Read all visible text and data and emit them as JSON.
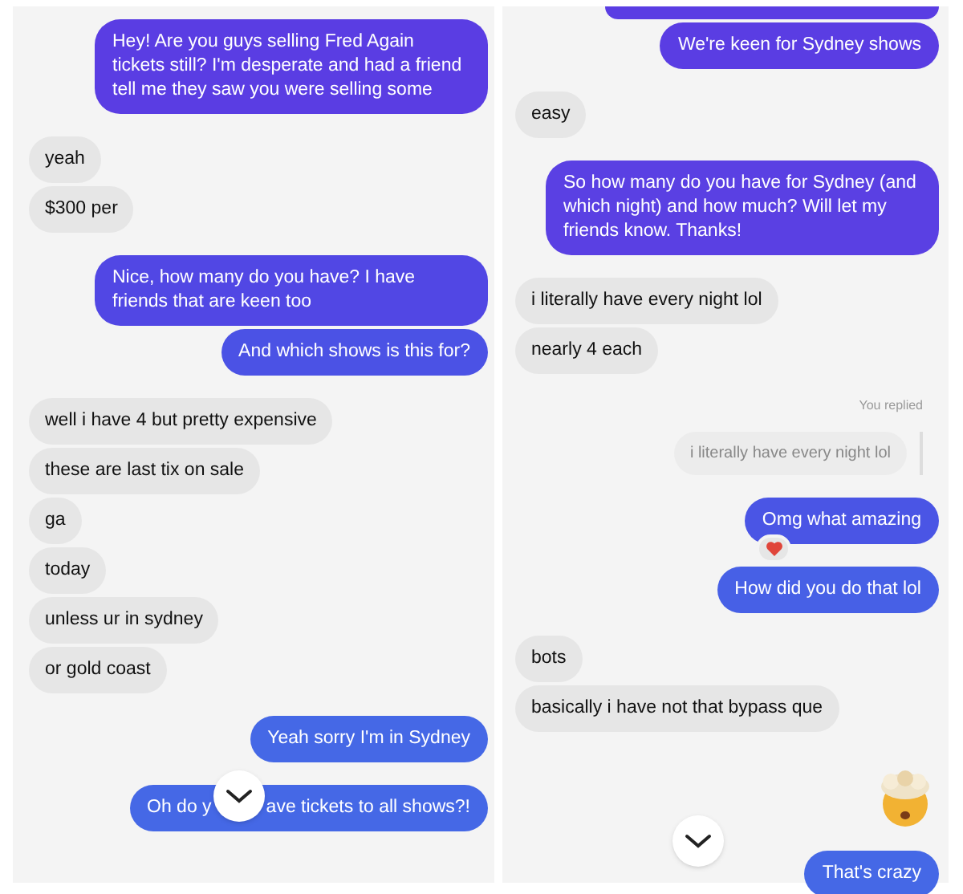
{
  "panels": [
    {
      "messages": [
        {
          "kind": "sent",
          "text": "Hey! Are you guys selling Fred Again tickets still? I'm desperate and had a friend tell me they saw you were selling some",
          "color": "#5a3de3"
        },
        {
          "kind": "received",
          "text": "yeah"
        },
        {
          "kind": "received",
          "text": "$300 per"
        },
        {
          "kind": "sent",
          "text": "Nice, how many do you have? I have friends that are keen too",
          "color": "#5147e4"
        },
        {
          "kind": "sent",
          "text": "And which shows is this for?",
          "color": "#4b52e5"
        },
        {
          "kind": "received",
          "text": "well i have 4 but pretty expensive"
        },
        {
          "kind": "received",
          "text": "these are last tix on sale"
        },
        {
          "kind": "received",
          "text": "ga"
        },
        {
          "kind": "received",
          "text": "today"
        },
        {
          "kind": "received",
          "text": "unless ur in sydney"
        },
        {
          "kind": "received",
          "text": "or gold coast"
        },
        {
          "kind": "sent",
          "text": "Yeah sorry I'm in Sydney",
          "color": "#4568e6"
        },
        {
          "kind": "covered",
          "text": "Oh do y",
          "text_after": "ave tickets to all shows?!",
          "color": "#4568e6"
        }
      ]
    },
    {
      "messages": [
        {
          "kind": "clipped",
          "color": "#5a3de3"
        },
        {
          "kind": "sent",
          "text": "We're keen for Sydney shows",
          "color": "#5a3de3"
        },
        {
          "kind": "received",
          "text": "easy"
        },
        {
          "kind": "sent",
          "text": "So how many do you have for Sydney (and which night) and how much? Will let my friends know. Thanks!",
          "color": "#5a40e3"
        },
        {
          "kind": "received",
          "text": "i literally have every night lol"
        },
        {
          "kind": "received",
          "text": "nearly 4 each"
        },
        {
          "kind": "quote",
          "label": "You replied",
          "text": "i literally have every night lol"
        },
        {
          "kind": "sent",
          "text": "Omg what amazing",
          "color": "#4a55e5",
          "reaction": true
        },
        {
          "kind": "sent",
          "text": "How did you do that lol",
          "color": "#4760e6"
        },
        {
          "kind": "received",
          "text": "bots"
        },
        {
          "kind": "received",
          "text": "basically i have not that bypass que"
        },
        {
          "kind": "emoji"
        },
        {
          "kind": "sent",
          "text": "That's crazy",
          "color": "#4568e6",
          "scroll_button": true
        }
      ]
    }
  ]
}
